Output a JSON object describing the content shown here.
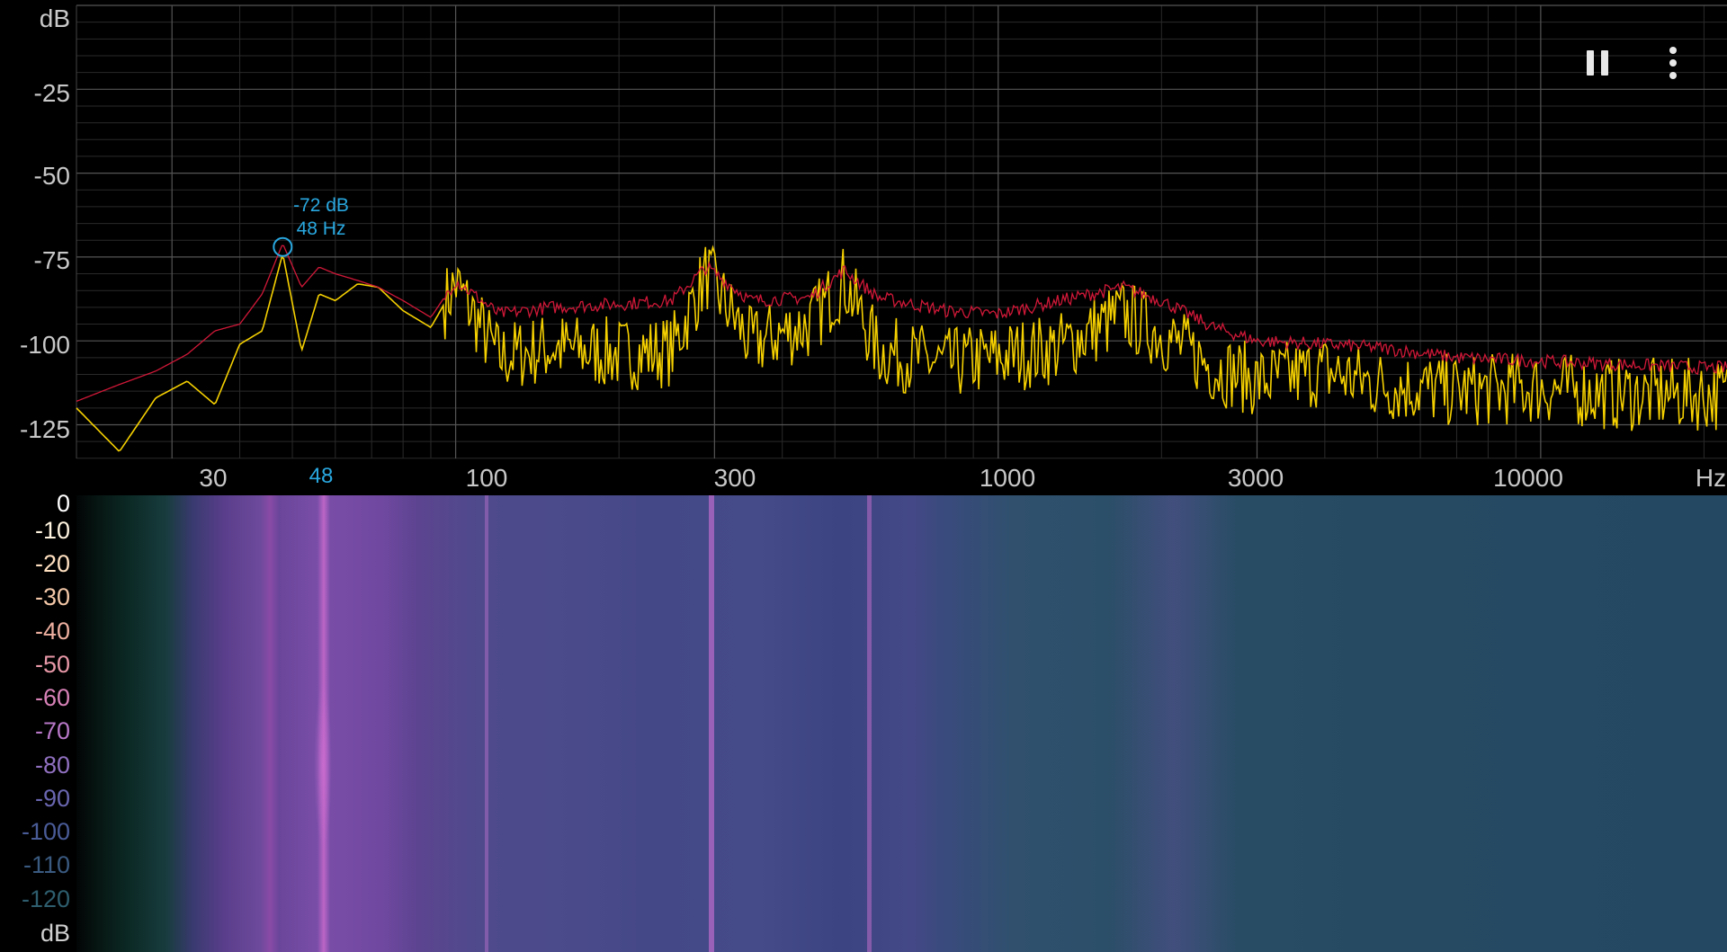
{
  "spectrum": {
    "y_unit": "dB",
    "y_ticks": [
      "-25",
      "-50",
      "-75",
      "-100",
      "-125"
    ],
    "x_ticks": [
      "30",
      "100",
      "300",
      "1000",
      "3000",
      "10000"
    ],
    "x_unit": "Hz",
    "peak": {
      "db_label": "-72 dB",
      "hz_label": "48 Hz",
      "axis_label": "48"
    },
    "colors": {
      "live": "#f5d000",
      "peak_hold": "#d01838",
      "peak_marker": "#29a8e0",
      "grid": "#333333"
    }
  },
  "toolbar": {
    "pause_icon": "pause-icon",
    "more_icon": "more-vert-icon"
  },
  "spectrogram": {
    "scale_ticks": [
      "0",
      "-10",
      "-20",
      "-30",
      "-40",
      "-50",
      "-60",
      "-70",
      "-80",
      "-90",
      "-100",
      "-110",
      "-120"
    ],
    "scale_unit": "dB",
    "scale_colors": [
      "#ffffff",
      "#fff4e0",
      "#ffe0c0",
      "#f4c8a8",
      "#eeb0a0",
      "#e898a8",
      "#d882b8",
      "#b878c8",
      "#9070c0",
      "#6a66b0",
      "#4a5c98",
      "#3a5a80",
      "#2e5e6e"
    ]
  },
  "chart_data": {
    "type": "line",
    "xlabel": "Hz",
    "ylabel": "dB",
    "xscale": "log",
    "xlim": [
      20,
      22050
    ],
    "ylim": [
      -138,
      0
    ],
    "grid": true,
    "series": [
      {
        "color": "#f5d000",
        "x": [
          20,
          24,
          28,
          32,
          36,
          40,
          44,
          48,
          52,
          56,
          60,
          66,
          72,
          80,
          90,
          100,
          120,
          150,
          200,
          250,
          290,
          350,
          450,
          520,
          600,
          800,
          1000,
          1300,
          1700,
          2000,
          2500,
          3000,
          4000,
          5000,
          7000,
          10000,
          14000,
          20000
        ],
        "y": [
          -120,
          -133,
          -117,
          -112,
          -119,
          -101,
          -97,
          -74,
          -103,
          -86,
          -88,
          -83,
          -84,
          -91,
          -96,
          -83,
          -105,
          -102,
          -104,
          -103,
          -80,
          -101,
          -95,
          -82,
          -103,
          -107,
          -105,
          -102,
          -92,
          -98,
          -108,
          -112,
          -109,
          -113,
          -115,
          -114,
          -116,
          -116
        ]
      },
      {
        "color": "#d01838",
        "x": [
          20,
          24,
          28,
          32,
          36,
          40,
          44,
          48,
          52,
          56,
          60,
          66,
          72,
          80,
          90,
          100,
          120,
          150,
          200,
          250,
          290,
          350,
          450,
          520,
          600,
          800,
          1000,
          1300,
          1700,
          2000,
          2500,
          3000,
          4000,
          5000,
          7000,
          10000,
          14000,
          20000
        ],
        "y": [
          -118,
          -113,
          -109,
          -104,
          -97,
          -95,
          -86,
          -71,
          -84,
          -78,
          -80,
          -82,
          -84,
          -88,
          -93,
          -82,
          -92,
          -90,
          -89,
          -88,
          -78,
          -88,
          -87,
          -79,
          -87,
          -91,
          -92,
          -88,
          -84,
          -88,
          -96,
          -100,
          -101,
          -102,
          -105,
          -106,
          -107,
          -108
        ]
      }
    ]
  }
}
